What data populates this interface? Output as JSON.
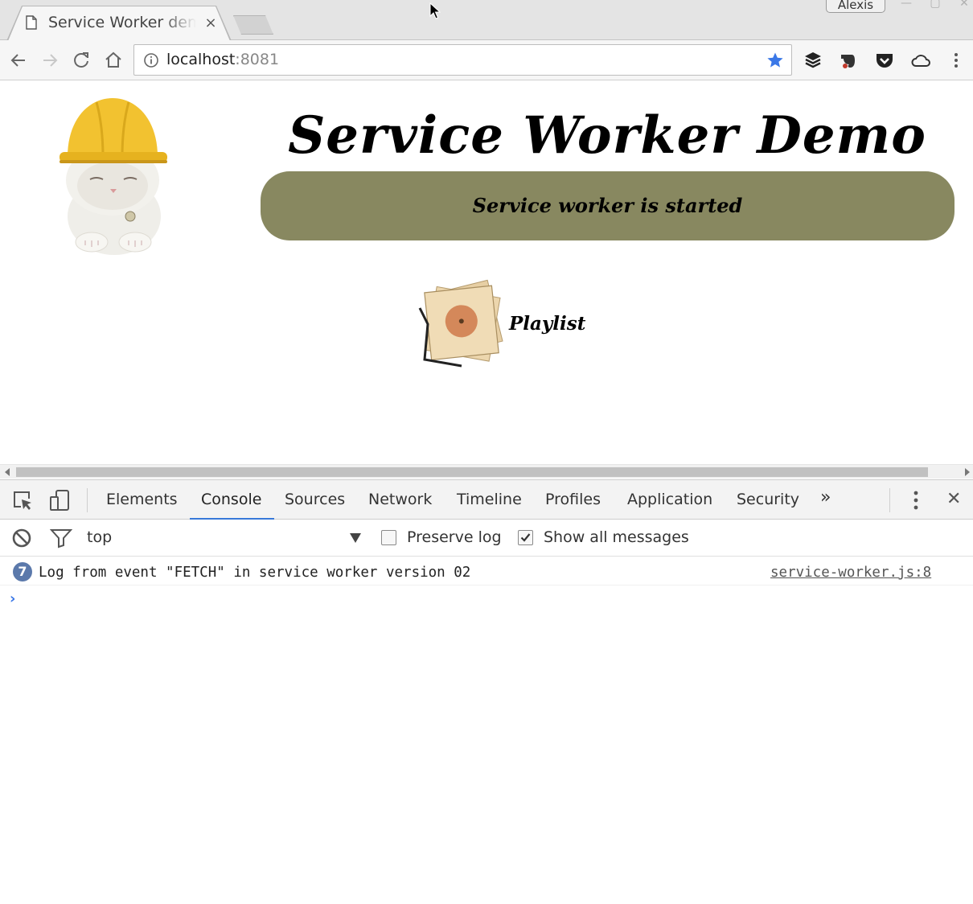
{
  "browser": {
    "tab_title": "Service Worker demo",
    "tab_close": "×",
    "profile_name": "Alexis",
    "url_host": "localhost",
    "url_port": ":8081"
  },
  "page": {
    "title": "Service Worker Demo",
    "status": "Service worker is started",
    "playlist_label": "Playlist"
  },
  "devtools": {
    "tabs": [
      {
        "label": "Elements"
      },
      {
        "label": "Console"
      },
      {
        "label": "Sources"
      },
      {
        "label": "Network"
      },
      {
        "label": "Timeline"
      },
      {
        "label": "Profiles"
      },
      {
        "label": "Application"
      },
      {
        "label": "Security"
      }
    ],
    "active_tab": "Console",
    "more_tabs": "»",
    "close": "✕",
    "context": "top",
    "preserve_log_label": "Preserve log",
    "preserve_log_checked": false,
    "show_all_label": "Show all messages",
    "show_all_checked": true,
    "log": {
      "count": "7",
      "message": "Log from event \"FETCH\" in service worker version 02",
      "source": "service-worker.js:8"
    },
    "prompt": "›"
  },
  "colors": {
    "status_banner": "#888860",
    "active_tab_underline": "#3879d9",
    "star": "#3b78e7",
    "log_badge": "#5b79ab"
  }
}
